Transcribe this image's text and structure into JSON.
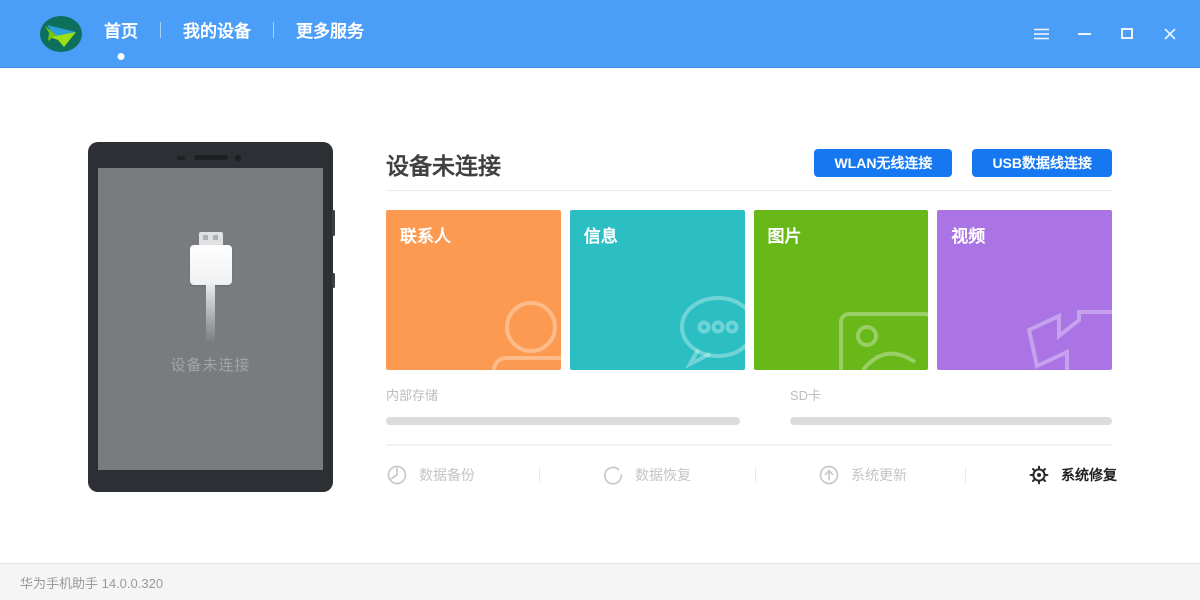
{
  "titlebar": {
    "nav": [
      {
        "label": "首页",
        "active": true
      },
      {
        "label": "我的设备",
        "active": false
      },
      {
        "label": "更多服务",
        "active": false
      }
    ],
    "window_controls": [
      {
        "name": "menu-icon"
      },
      {
        "name": "minimize-icon"
      },
      {
        "name": "maximize-icon"
      },
      {
        "name": "close-icon"
      }
    ]
  },
  "phone_preview": {
    "status_text": "设备未连接"
  },
  "content": {
    "title": "设备未连接",
    "connect_buttons": [
      {
        "label": "WLAN无线连接"
      },
      {
        "label": "USB数据线连接"
      }
    ],
    "tiles": [
      {
        "label": "联系人",
        "icon": "contact-person-icon",
        "color": "#FB9A50"
      },
      {
        "label": "信息",
        "icon": "message-bubble-icon",
        "color": "#2BBFC3"
      },
      {
        "label": "图片",
        "icon": "picture-frame-icon",
        "color": "#67B818"
      },
      {
        "label": "视频",
        "icon": "video-camera-icon",
        "color": "#AB74E5"
      }
    ],
    "storage": [
      {
        "label": "内部存储",
        "percent": 0
      },
      {
        "label": "SD卡",
        "percent": 0
      }
    ],
    "actions": [
      {
        "label": "数据备份",
        "icon": "backup-clock-icon",
        "enabled": false
      },
      {
        "label": "数据恢复",
        "icon": "restore-arrow-icon",
        "enabled": false
      },
      {
        "label": "系统更新",
        "icon": "update-arrow-icon",
        "enabled": false
      },
      {
        "label": "系统修复",
        "icon": "repair-gear-icon",
        "enabled": true
      }
    ]
  },
  "statusbar": {
    "text": "华为手机助手 14.0.0.320"
  },
  "colors": {
    "header_blue": "#4A9EF8",
    "button_blue": "#1678F0",
    "tile_orange": "#FB9A50",
    "tile_teal": "#2BBFC3",
    "tile_green": "#67B818",
    "tile_purple": "#AB74E5",
    "phone_bezel": "#2C2F33",
    "phone_screen": "#797C7F"
  }
}
